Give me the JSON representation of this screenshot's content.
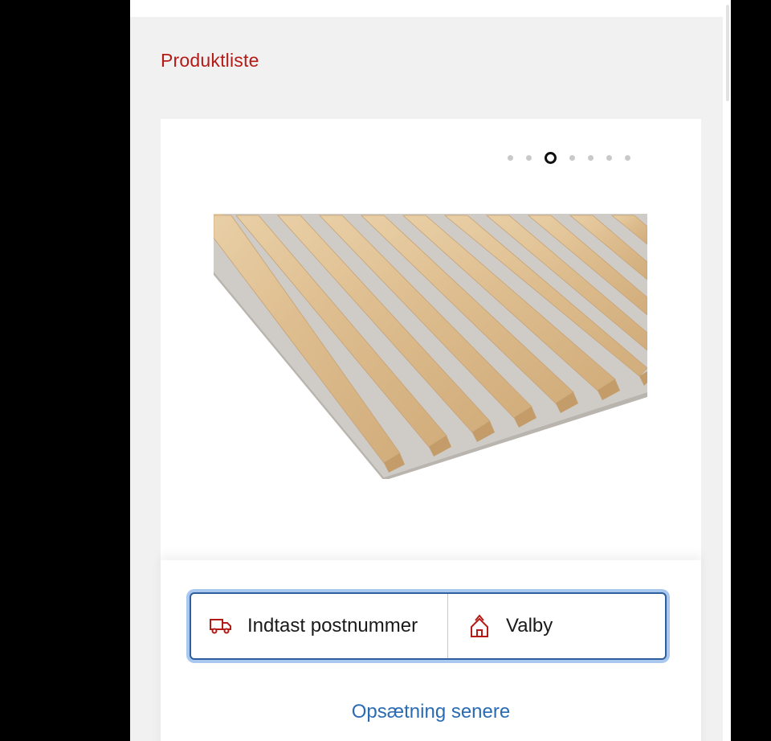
{
  "breadcrumb": {
    "label": "Produktliste"
  },
  "carousel": {
    "total": 7,
    "active_index": 2
  },
  "product": {
    "image": "wood-slat-acoustic-panel"
  },
  "store_selector": {
    "delivery_icon": "truck-icon",
    "delivery_label": "Indtast postnummer",
    "store_icon": "store-icon",
    "store_label": "Valby"
  },
  "later_link": {
    "label": "Opsætning senere"
  },
  "colors": {
    "accent_red": "#b41b17",
    "link_blue": "#2a6bb3",
    "focus_border": "#2f5f9c",
    "focus_glow": "#a9c8ef"
  }
}
